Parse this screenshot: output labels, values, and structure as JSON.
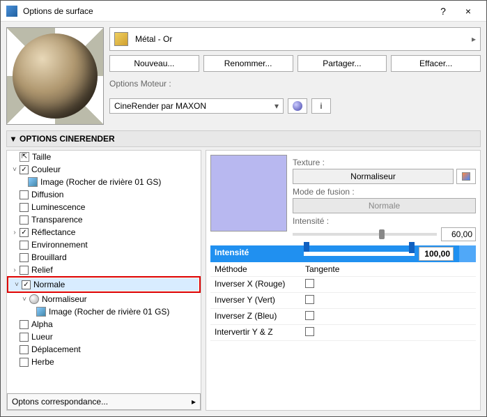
{
  "window": {
    "title": "Options de surface",
    "help": "?",
    "close": "×"
  },
  "material": {
    "name": "Métal - Or",
    "arrow": "▸"
  },
  "buttons": {
    "new": "Nouveau...",
    "rename": "Renommer...",
    "share": "Partager...",
    "delete": "Effacer..."
  },
  "engine": {
    "label": "Options Moteur :",
    "value": "CineRender par MAXON",
    "info": "i"
  },
  "section": {
    "title": "OPTIONS CINERENDER",
    "caret": "▾"
  },
  "tree": {
    "taille": "Taille",
    "couleur": "Couleur",
    "image_rocher": "Image (Rocher de rivière 01 GS)",
    "diffusion": "Diffusion",
    "luminescence": "Luminescence",
    "transparence": "Transparence",
    "reflectance": "Réflectance",
    "environnement": "Environnement",
    "brouillard": "Brouillard",
    "relief": "Relief",
    "normale": "Normale",
    "normaliseur": "Normaliseur",
    "image_rocher2": "Image (Rocher de rivière 01 GS)",
    "alpha": "Alpha",
    "lueur": "Lueur",
    "deplacement": "Déplacement",
    "herbe": "Herbe"
  },
  "matching": {
    "label": "Optons correspondance...",
    "arrow": "▸"
  },
  "props": {
    "texture_label": "Texture :",
    "texture_value": "Normaliseur",
    "blend_label": "Mode de fusion :",
    "blend_value": "Normale",
    "intensity_label": "Intensité :",
    "intensity_value": "60,00"
  },
  "params": {
    "intensite": {
      "label": "Intensité",
      "value": "100,00"
    },
    "methode": {
      "label": "Méthode",
      "value": "Tangente"
    },
    "inv_x": "Inverser X (Rouge)",
    "inv_y": "Inverser Y (Vert)",
    "inv_z": "Inverser Z (Bleu)",
    "swap_yz": "Intervertir Y & Z"
  }
}
